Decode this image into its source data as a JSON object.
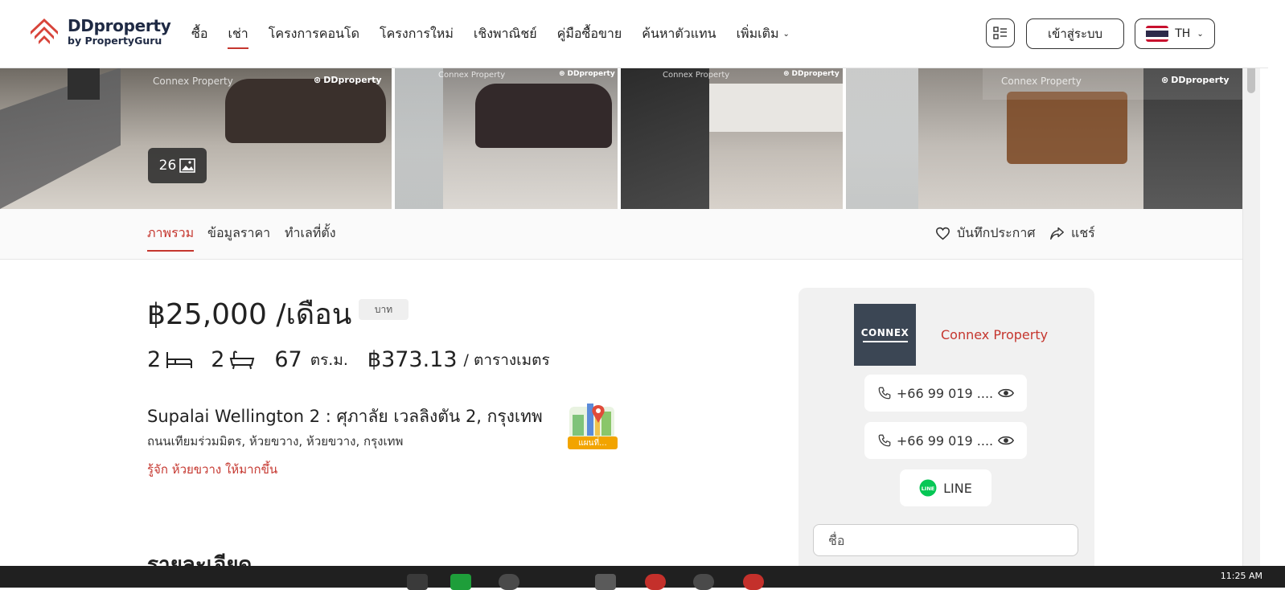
{
  "header": {
    "logo_main": "DDproperty",
    "logo_sub": "by PropertyGuru",
    "nav": [
      {
        "label": "ซื้อ",
        "active": false
      },
      {
        "label": "เช่า",
        "active": true
      },
      {
        "label": "โครงการคอนโด",
        "active": false
      },
      {
        "label": "โครงการใหม่",
        "active": false
      },
      {
        "label": "เชิงพาณิชย์",
        "active": false
      },
      {
        "label": "คู่มือซื้อขาย",
        "active": false
      },
      {
        "label": "ค้นหาตัวแทน",
        "active": false
      },
      {
        "label": "เพิ่มเติม",
        "active": false
      }
    ],
    "login_label": "เข้าสู่ระบบ",
    "language": "TH"
  },
  "gallery": {
    "photo_count": "26",
    "watermark_agency": "Connex Property",
    "watermark_brand": "DDproperty"
  },
  "subnav": {
    "tabs": [
      "ภาพรวม",
      "ข้อมูลราคา",
      "ทำเลที่ตั้ง"
    ],
    "active_tab": "ภาพรวม",
    "save_label": "บันทึกประกาศ",
    "share_label": "แชร์"
  },
  "listing": {
    "price": "฿25,000 /เดือน",
    "currency_tag": "บาท",
    "bedrooms": "2",
    "bathrooms": "2",
    "area_value": "67",
    "area_unit": "ตร.ม.",
    "price_per_sqm": "฿373.13",
    "price_per_sqm_unit": "/ ตารางเมตร",
    "project_line": "Supalai Wellington 2 : ศุภาลัย เวลลิงตัน 2, กรุงเทพ",
    "address": "ถนนเทียมร่วมมิตร, ห้วยขวาง, ห้วยขวาง, กรุงเทพ",
    "know_more": "รู้จัก ห้วยขวาง ให้มากขึ้น",
    "map_label": "แผนที่...",
    "details_heading": "รายละเอียด"
  },
  "agent": {
    "logo_text": "CONNEX",
    "name": "Connex Property",
    "phone_1": "+66 99 019 ....",
    "phone_2": "+66 99 019 ....",
    "line_label": "LINE",
    "name_placeholder": "ชื่อ"
  },
  "system": {
    "clock": "11:25 AM"
  },
  "colors": {
    "brand_red": "#c5362e",
    "brand_navy": "#1f2a44",
    "line_green": "#06c755",
    "agent_logo_bg": "#3b4654"
  }
}
